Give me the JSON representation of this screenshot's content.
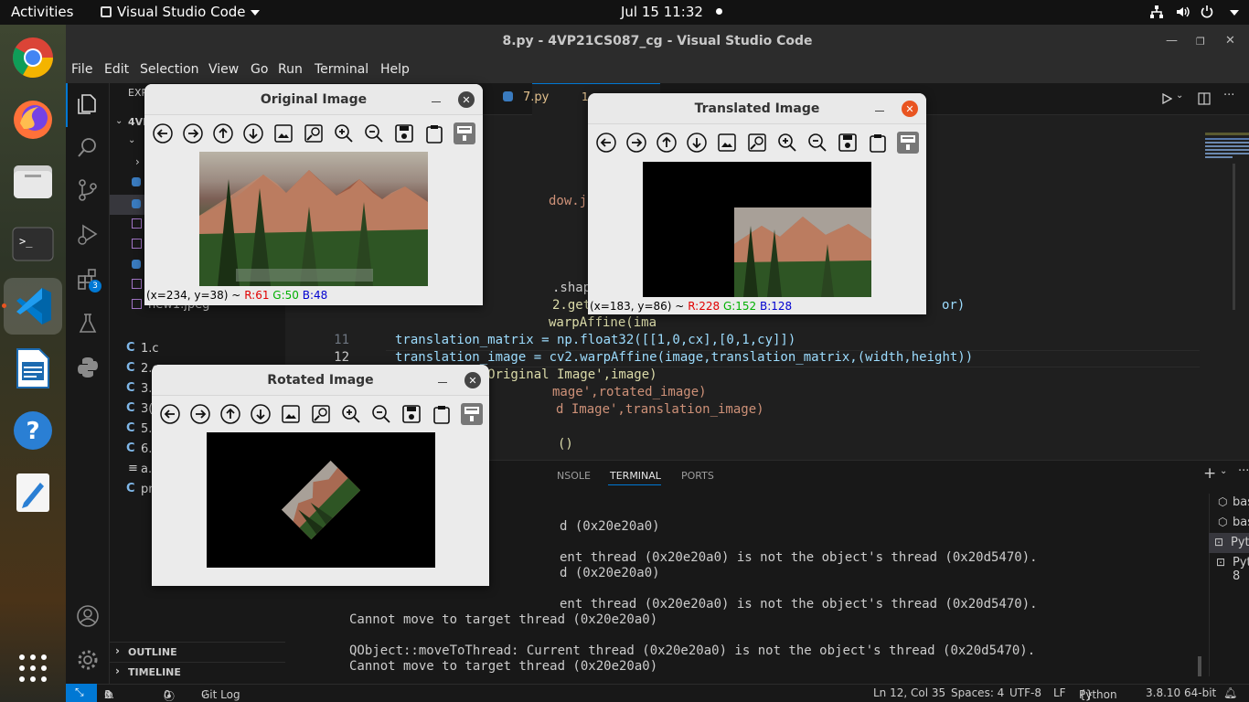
{
  "topbar": {
    "activities": "Activities",
    "app": "Visual Studio Code",
    "clock": "Jul 15  11:32"
  },
  "dock": {
    "items": [
      "chrome-icon",
      "firefox-icon",
      "files-icon",
      "terminal-icon",
      "vscode-icon",
      "writer-icon",
      "help-icon",
      "text-editor-icon"
    ],
    "badge_extensions": "3"
  },
  "window": {
    "title": "8.py - 4VP21CS087_cg - Visual Studio Code"
  },
  "menu": [
    "File",
    "Edit",
    "Selection",
    "View",
    "Go",
    "Run",
    "Terminal",
    "Help"
  ],
  "sidebar": {
    "header": "EXP",
    "root": "4VP",
    "files": [
      {
        "name": "new1.jpeg",
        "kind": "image"
      },
      {
        "name": "1.c",
        "kind": "c"
      },
      {
        "name": "2.cpp",
        "kind": "cpp"
      },
      {
        "name": "3.c",
        "kind": "cpp"
      },
      {
        "name": "3(",
        "kind": "c"
      },
      {
        "name": "5.",
        "kind": "cpp"
      },
      {
        "name": "6.",
        "kind": "cpp"
      },
      {
        "name": "a.",
        "kind": "text"
      },
      {
        "name": "pr",
        "kind": "c"
      }
    ],
    "outline": "OUTLINE",
    "timeline": "TIMELINE"
  },
  "editor": {
    "tab": {
      "name": "7.py",
      "problems": "1"
    },
    "lines": [
      {
        "n": "",
        "text": "dow.jpeg')"
      },
      {
        "n": "",
        "text": ".shape[:2]"
      },
      {
        "n": "",
        "text": "2.getRotationM"
      },
      {
        "n": "",
        "text": "warpAffine(ima"
      },
      {
        "n": "11",
        "text": "translation_matrix = np.float32([[1,0,cx],[0,1,cy]])"
      },
      {
        "n": "12",
        "text": "translation_image = cv2.warpAffine(image,translation_matrix,(width,height))"
      },
      {
        "n": "13",
        "text": "cv2.imshow('Original Image',image)"
      },
      {
        "n": "",
        "text": "mage',rotated_image)"
      },
      {
        "n": "",
        "text": "d Image',translation_image)"
      },
      {
        "n": "",
        "text": "()"
      }
    ],
    "line8_tail": "or)"
  },
  "panel": {
    "tabs": [
      "NSOLE",
      "TERMINAL",
      "PORTS"
    ],
    "active_tab": "TERMINAL",
    "lines": [
      "d (0x20e20a0)",
      "",
      "ent thread (0x20e20a0) is not the object's thread (0x20d5470).",
      "d (0x20e20a0)",
      "",
      "ent thread (0x20e20a0) is not the object's thread (0x20d5470).",
      "Cannot move to target thread (0x20e20a0)",
      "",
      "QObject::moveToThread: Current thread (0x20e20a0) is not the object's thread (0x20d5470).",
      "Cannot move to target thread (0x20e20a0)"
    ],
    "terminals": [
      {
        "name": "bash",
        "suffix": "ip",
        "warn": true
      },
      {
        "name": "bash",
        "suffix": "",
        "warn": false
      },
      {
        "name": "Python",
        "suffix": "ip",
        "warn": false,
        "active": true
      },
      {
        "name": "Python: 8",
        "suffix": "",
        "warn": false
      }
    ]
  },
  "statusbar": {
    "errors": "0",
    "warnings": "3",
    "ports": "0",
    "gitlog": "Git Log",
    "position": "Ln 12, Col 35",
    "spaces": "Spaces: 4",
    "encoding": "UTF-8",
    "eol": "LF",
    "language": "Python",
    "interpreter": "3.8.10 64-bit"
  },
  "cv_windows": {
    "original": {
      "title": "Original Image",
      "coords": "(x=234, y=38) ~",
      "r": "R:61",
      "g": "G:50",
      "b": "B:48"
    },
    "translated": {
      "title": "Translated Image",
      "coords": "(x=183, y=86) ~",
      "r": "R:228",
      "g": "G:152",
      "b": "B:128"
    },
    "rotated": {
      "title": "Rotated Image"
    }
  },
  "colors": {
    "keyword_var": "#9cdcfe",
    "string": "#ce9178",
    "function": "#dcdcaa",
    "accent": "#0078d4",
    "close_orange": "#e95420"
  }
}
